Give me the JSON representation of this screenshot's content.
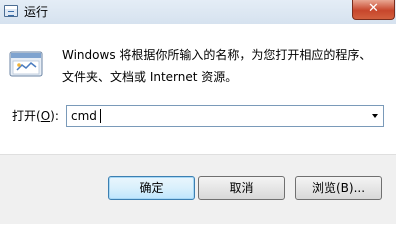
{
  "window": {
    "title": "运行",
    "close_symbol": "✕"
  },
  "description": {
    "line1": "Windows 将根据你所输入的名称，为您打开相应的程序、",
    "line2": "文件夹、文档或 Internet 资源。"
  },
  "open": {
    "label_prefix": "打开(",
    "label_key": "O",
    "label_suffix": "):",
    "value": "cmd"
  },
  "buttons": {
    "ok_label": "确定",
    "cancel_label": "取消",
    "browse_label": "浏览(B)..."
  },
  "icons": {
    "title": "run-window-icon",
    "run": "run-program-icon",
    "dropdown": "chevron-down-icon"
  },
  "colors": {
    "titlebar": "#dae5f1",
    "close_button": "#c7462c",
    "footer": "#f0f0f0",
    "default_button_border": "#3c7fb1"
  }
}
